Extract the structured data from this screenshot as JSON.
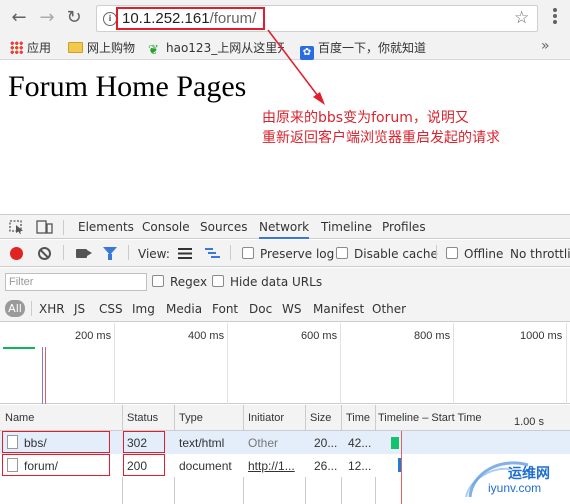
{
  "browser": {
    "url_host": "10.1.252.161",
    "url_path": "/forum/",
    "nav": {
      "back": "←",
      "forward": "→",
      "reload": "↻"
    },
    "icons": [
      "back-arrow-icon",
      "forward-arrow-icon",
      "reload-icon",
      "info-icon",
      "star-icon",
      "menu-icon"
    ]
  },
  "bookmarks": [
    {
      "label": "应用",
      "icon": "apps-icon"
    },
    {
      "label": "网上购物",
      "icon": "folder-icon"
    },
    {
      "label": "hao123_上网从这里开",
      "icon": "hao123-icon"
    },
    {
      "label": "百度一下，你就知道",
      "icon": "baidu-paw-icon"
    }
  ],
  "bookmarks_more": "»",
  "page": {
    "title": "Forum Home Pages"
  },
  "annotation": {
    "line1": "由原来的bbs变为forum，说明又",
    "line2": "重新返回客户端浏览器重启发起的请求",
    "color": "#d9242e"
  },
  "devtools": {
    "tabs": [
      "Elements",
      "Console",
      "Sources",
      "Network",
      "Timeline",
      "Profiles"
    ],
    "active_tab": "Network",
    "network_bar": {
      "view_label": "View:",
      "preserve_log": "Preserve log",
      "disable_cache": "Disable cache",
      "offline": "Offline",
      "throttling": "No throttlin"
    },
    "filter": {
      "placeholder": "Filter",
      "regex": "Regex",
      "hide_data_urls": "Hide data URLs"
    },
    "types": [
      "All",
      "XHR",
      "JS",
      "CSS",
      "Img",
      "Media",
      "Font",
      "Doc",
      "WS",
      "Manifest",
      "Other"
    ],
    "overview_ticks": [
      "200 ms",
      "400 ms",
      "600 ms",
      "800 ms",
      "1000 ms"
    ],
    "columns": {
      "name": "Name",
      "status": "Status",
      "type": "Type",
      "initiator": "Initiator",
      "size": "Size",
      "time": "Time",
      "timeline": "Timeline – Start Time",
      "timeline_scale": "1.00 s"
    },
    "rows": [
      {
        "name": "bbs/",
        "status": "302",
        "type": "text/html",
        "initiator": "Other",
        "size": "20...",
        "time": "42..."
      },
      {
        "name": "forum/",
        "status": "200",
        "type": "document",
        "initiator": "http://1...",
        "size": "26...",
        "time": "12..."
      }
    ]
  },
  "watermark": {
    "cn": "运维网",
    "en": "iyunv.com"
  }
}
